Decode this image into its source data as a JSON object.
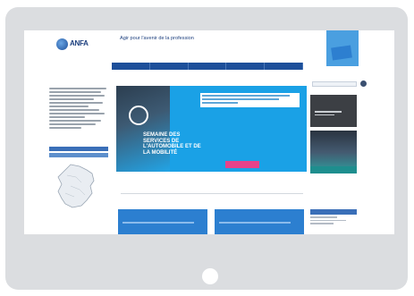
{
  "device": {
    "type": "tablet",
    "frame_color": "#dbdde0"
  },
  "site": {
    "logo_text": "ANFA",
    "tagline": "Agir pour l'avenir de la profession",
    "subtagline": "",
    "brand_color": "#1d4f9a"
  },
  "nav": {
    "items": [
      "",
      "",
      "",
      "",
      ""
    ]
  },
  "search": {
    "placeholder": ""
  },
  "hero": {
    "title": "SEMAINE DES SERVICES DE L'AUTOMOBILE ET DE LA MOBILITÉ",
    "button_label": "",
    "accent_color": "#1aa1e6",
    "button_color": "#e8428a"
  },
  "main": {
    "section_title": ""
  },
  "cards": [
    {
      "title": ""
    },
    {
      "title": ""
    }
  ]
}
